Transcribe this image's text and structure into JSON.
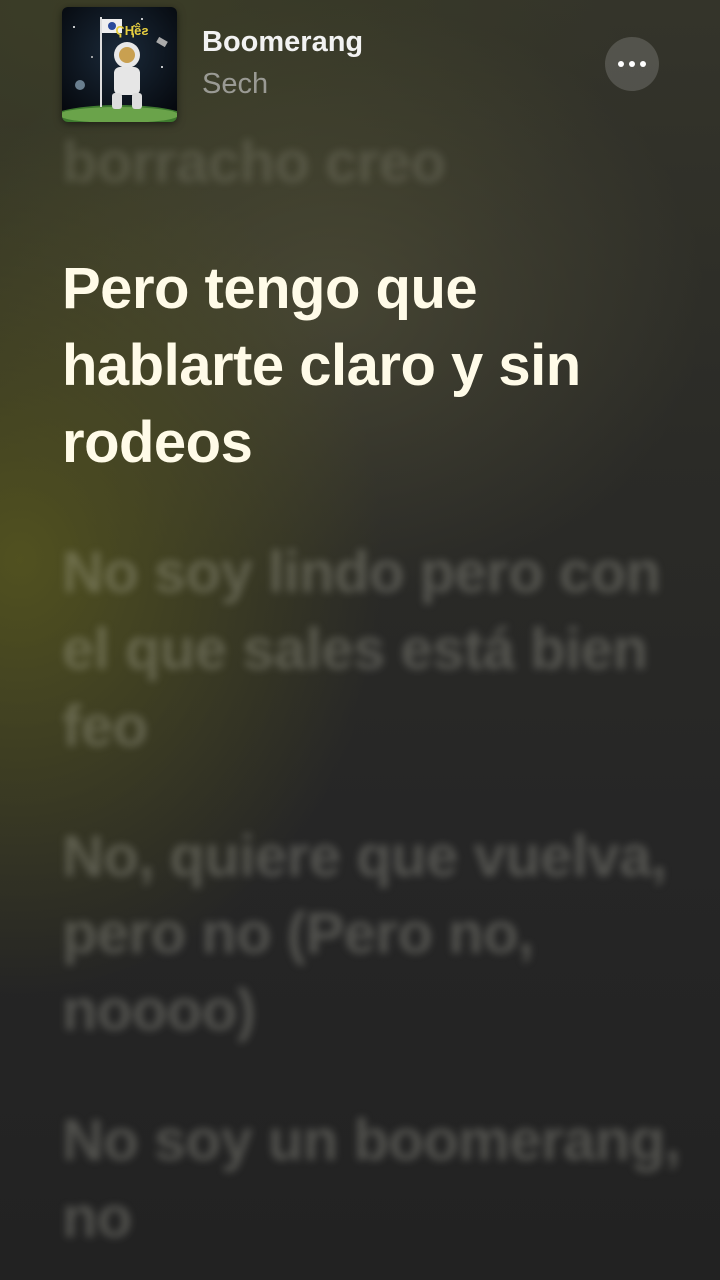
{
  "now_playing": {
    "title": "Boomerang",
    "artist": "Sech",
    "more_icon": "ellipsis-icon"
  },
  "lyrics": {
    "previous_line": "borracho creo",
    "current_line": "Pero tengo que hablarte claro y sin rodeos",
    "next_lines": [
      "No soy lindo pero con el que sales está bien feo",
      "No, quiere que vuelva, pero no (Pero no, noooo)",
      "No soy un boomerang, no"
    ]
  },
  "colors": {
    "active_lyric": "#fffbe8",
    "title": "#f2f2f2",
    "artist": "#9a9a94"
  }
}
